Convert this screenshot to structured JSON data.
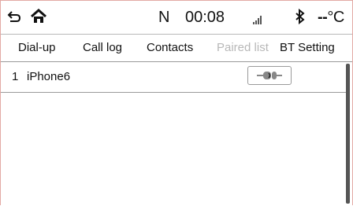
{
  "status_bar": {
    "back_icon": "back-arrow-icon",
    "home_icon": "home-icon",
    "gear": "N",
    "time": "00:08",
    "signal_icon": "signal-bars-icon",
    "bluetooth_icon": "bluetooth-icon",
    "temperature": "--",
    "temperature_unit": "°C"
  },
  "tabs": [
    {
      "label": "Dial-up",
      "active": false
    },
    {
      "label": "Call log",
      "active": false
    },
    {
      "label": "Contacts",
      "active": false
    },
    {
      "label": "Paired list",
      "active": true
    },
    {
      "label": "BT Setting",
      "active": false
    }
  ],
  "paired_devices": [
    {
      "index": "1",
      "name": "iPhone6",
      "action_icon": "plug-connect-icon"
    }
  ],
  "colors": {
    "active_tab_text": "#b8b8b8",
    "text": "#111111",
    "divider": "#9a9a9a",
    "scrollbar": "#555555",
    "frame_border": "#e3a9a4"
  }
}
